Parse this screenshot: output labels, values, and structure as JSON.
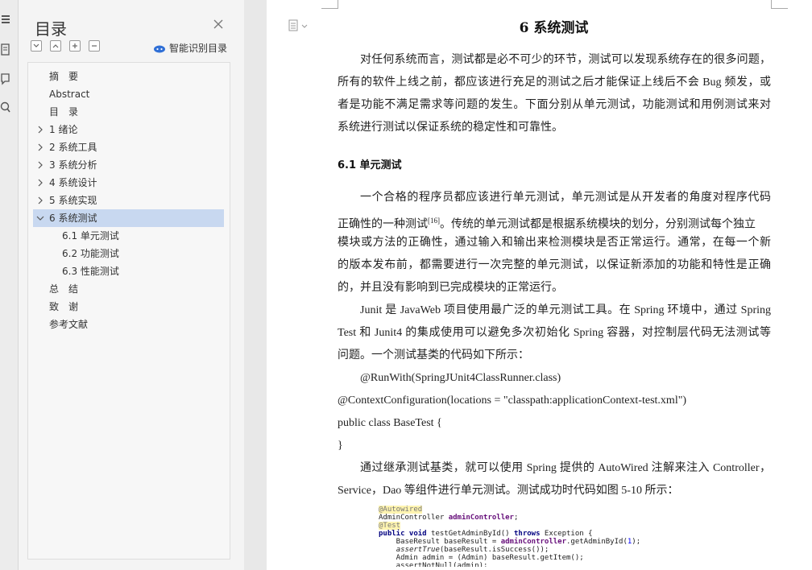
{
  "nav": {
    "title": "目录",
    "smart_label": "智能识别目录",
    "items": [
      {
        "label": "摘　要",
        "level": 1,
        "expandable": false,
        "selected": false
      },
      {
        "label": "Abstract",
        "level": 1,
        "expandable": false,
        "selected": false
      },
      {
        "label": "目　录",
        "level": 1,
        "expandable": false,
        "selected": false
      },
      {
        "label": "1 绪论",
        "level": 1,
        "expandable": true,
        "selected": false
      },
      {
        "label": "2 系统工具",
        "level": 1,
        "expandable": true,
        "selected": false
      },
      {
        "label": "3 系统分析",
        "level": 1,
        "expandable": true,
        "selected": false
      },
      {
        "label": "4 系统设计",
        "level": 1,
        "expandable": true,
        "selected": false
      },
      {
        "label": "5 系统实现",
        "level": 1,
        "expandable": true,
        "selected": false
      },
      {
        "label": "6 系统测试",
        "level": 1,
        "expandable": true,
        "expanded": true,
        "selected": true
      },
      {
        "label": "6.1 单元测试",
        "level": 2,
        "expandable": false,
        "selected": false
      },
      {
        "label": "6.2 功能测试",
        "level": 2,
        "expandable": false,
        "selected": false
      },
      {
        "label": "6.3 性能测试",
        "level": 2,
        "expandable": false,
        "selected": false
      },
      {
        "label": "总　结",
        "level": 1,
        "expandable": false,
        "selected": false
      },
      {
        "label": "致　谢",
        "level": 1,
        "expandable": false,
        "selected": false
      },
      {
        "label": "参考文献",
        "level": 1,
        "expandable": false,
        "selected": false
      }
    ]
  },
  "doc": {
    "heading": "6 系统测试",
    "p1": [
      "对任何系统而言，测试都是必不可少的环节，测试可以发现系统存在的很多问题，",
      "所有的软件上线之前，都应该进行充足的测试之后才能保证上线后不会 Bug 频发，或",
      "者是功能不满足需求等问题的发生。下面分别从单元测试，功能测试和用例测试来对",
      "系统进行测试以保证系统的稳定性和可靠性。"
    ],
    "section": "6.1 单元测试",
    "p2_l1": "一个合格的程序员都应该进行单元测试，单元测试是从开发者的角度对程序代码",
    "p2_l2a": "正确性的一种测试",
    "p2_l2sup": "[16]",
    "p2_l2b": "。传统的单元测试都是根据系统模块的划分，分别测试每个独立",
    "p2_rest": [
      "模块或方法的正确性，通过输入和输出来检测模块是否正常运行。通常，在每一个新",
      "的版本发布前，都需要进行一次完整的单元测试，以保证新添加的功能和特性是正确",
      "的，并且没有影响到已完成模块的正常运行。"
    ],
    "p3": [
      "Junit 是 JavaWeb 项目使用最广泛的单元测试工具。在 Spring 环境中，通过 Spring",
      "Test 和  Junit4 的集成使用可以避免多次初始化 Spring 容器，对控制层代码无法测试等",
      "问题。一个测试基类的代码如下所示："
    ],
    "code_lines": [
      "@RunWith(SpringJUnit4ClassRunner.class)",
      "@ContextConfiguration(locations = \"classpath:applicationContext-test.xml\")",
      "public class BaseTest {",
      "}"
    ],
    "p4": [
      "通过继承测试基类，就可以使用 Spring 提供的 AutoWired 注解来注入 Controller，",
      "Service，Dao 等组件进行单元测试。测试成功时代码如图 5-10 所示："
    ],
    "snippet": {
      "l1": "@Autowired",
      "l2a": "AdminController ",
      "l2b": "adminController",
      "l2c": ";",
      "l3": "@Test",
      "l4a": "public void ",
      "l4b": "testGetAdminById() ",
      "l4c": "throws ",
      "l4d": "Exception {",
      "l5a": "    BaseResult baseResult = ",
      "l5b": "adminController",
      "l5c": ".getAdminById(",
      "l5d": "1",
      "l5e": ");",
      "l6a": "    ",
      "l6b": "assertTrue",
      "l6c": "(baseResult.isSuccess());",
      "l7": "    Admin admin = (Admin) baseResult.getItem();",
      "l8": "    assertNotNull(admin);"
    }
  },
  "colors": {
    "selected_bg": "#c8d8f0",
    "accent": "#2f6fd6"
  }
}
